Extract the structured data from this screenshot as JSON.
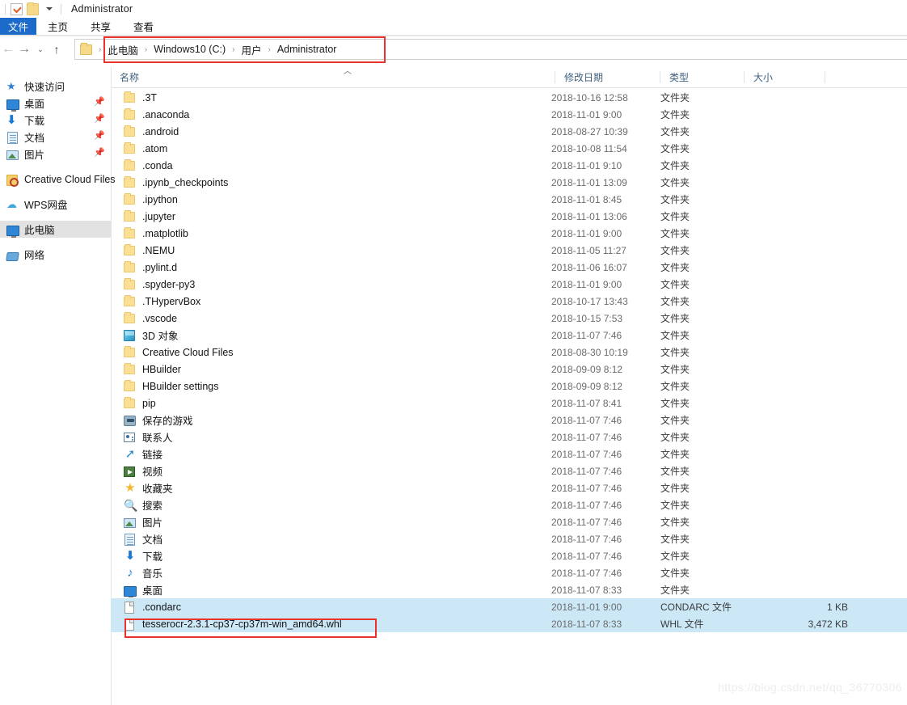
{
  "window": {
    "title": "Administrator",
    "quick_access_icons": [
      "properties-check-icon",
      "new-folder-icon",
      "customize-caret-icon"
    ]
  },
  "ribbon": {
    "file_tab": "文件",
    "tabs": [
      "主页",
      "共享",
      "查看"
    ]
  },
  "navigation": {
    "back": "←",
    "forward": "→",
    "recent": "⌄",
    "up": "↑",
    "breadcrumb": [
      "此电脑",
      "Windows10 (C:)",
      "用户",
      "Administrator"
    ],
    "separator": "›"
  },
  "columns": {
    "name": "名称",
    "date": "修改日期",
    "type": "类型",
    "size": "大小",
    "sort_indicator": "︿"
  },
  "sidebar": {
    "groups": [
      {
        "items": [
          {
            "label": "快速访问",
            "icon": "quick-access-star-icon",
            "pinned": false,
            "selected": false
          },
          {
            "label": "桌面",
            "icon": "desktop-monitor-icon",
            "pinned": true,
            "selected": false
          },
          {
            "label": "下载",
            "icon": "downloads-arrow-icon",
            "pinned": true,
            "selected": false
          },
          {
            "label": "文档",
            "icon": "documents-icon",
            "pinned": true,
            "selected": false
          },
          {
            "label": "图片",
            "icon": "pictures-icon",
            "pinned": true,
            "selected": false
          }
        ]
      },
      {
        "items": [
          {
            "label": "Creative Cloud Files",
            "icon": "creative-cloud-icon",
            "pinned": false,
            "selected": false
          }
        ]
      },
      {
        "items": [
          {
            "label": "WPS网盘",
            "icon": "wps-cloud-icon",
            "pinned": false,
            "selected": false
          }
        ]
      },
      {
        "items": [
          {
            "label": "此电脑",
            "icon": "this-pc-icon",
            "pinned": false,
            "selected": true
          }
        ]
      },
      {
        "items": [
          {
            "label": "网络",
            "icon": "network-icon",
            "pinned": false,
            "selected": false
          }
        ]
      }
    ]
  },
  "files": [
    {
      "name": ".3T",
      "date": "2018-10-16 12:58",
      "type": "文件夹",
      "size": "",
      "icon": "folder-icon",
      "selected": false
    },
    {
      "name": ".anaconda",
      "date": "2018-11-01 9:00",
      "type": "文件夹",
      "size": "",
      "icon": "folder-icon",
      "selected": false
    },
    {
      "name": ".android",
      "date": "2018-08-27 10:39",
      "type": "文件夹",
      "size": "",
      "icon": "folder-icon",
      "selected": false
    },
    {
      "name": ".atom",
      "date": "2018-10-08 11:54",
      "type": "文件夹",
      "size": "",
      "icon": "folder-icon",
      "selected": false
    },
    {
      "name": ".conda",
      "date": "2018-11-01 9:10",
      "type": "文件夹",
      "size": "",
      "icon": "folder-icon",
      "selected": false
    },
    {
      "name": ".ipynb_checkpoints",
      "date": "2018-11-01 13:09",
      "type": "文件夹",
      "size": "",
      "icon": "folder-icon",
      "selected": false
    },
    {
      "name": ".ipython",
      "date": "2018-11-01 8:45",
      "type": "文件夹",
      "size": "",
      "icon": "folder-icon",
      "selected": false
    },
    {
      "name": ".jupyter",
      "date": "2018-11-01 13:06",
      "type": "文件夹",
      "size": "",
      "icon": "folder-icon",
      "selected": false
    },
    {
      "name": ".matplotlib",
      "date": "2018-11-01 9:00",
      "type": "文件夹",
      "size": "",
      "icon": "folder-icon",
      "selected": false
    },
    {
      "name": ".NEMU",
      "date": "2018-11-05 11:27",
      "type": "文件夹",
      "size": "",
      "icon": "folder-icon",
      "selected": false
    },
    {
      "name": ".pylint.d",
      "date": "2018-11-06 16:07",
      "type": "文件夹",
      "size": "",
      "icon": "folder-icon",
      "selected": false
    },
    {
      "name": ".spyder-py3",
      "date": "2018-11-01 9:00",
      "type": "文件夹",
      "size": "",
      "icon": "folder-icon",
      "selected": false
    },
    {
      "name": ".THypervBox",
      "date": "2018-10-17 13:43",
      "type": "文件夹",
      "size": "",
      "icon": "folder-icon",
      "selected": false
    },
    {
      "name": ".vscode",
      "date": "2018-10-15 7:53",
      "type": "文件夹",
      "size": "",
      "icon": "folder-icon",
      "selected": false
    },
    {
      "name": "3D 对象",
      "date": "2018-11-07 7:46",
      "type": "文件夹",
      "size": "",
      "icon": "3d-objects-icon",
      "selected": false
    },
    {
      "name": "Creative Cloud Files",
      "date": "2018-08-30 10:19",
      "type": "文件夹",
      "size": "",
      "icon": "folder-icon",
      "selected": false
    },
    {
      "name": "HBuilder",
      "date": "2018-09-09 8:12",
      "type": "文件夹",
      "size": "",
      "icon": "folder-icon",
      "selected": false
    },
    {
      "name": "HBuilder settings",
      "date": "2018-09-09 8:12",
      "type": "文件夹",
      "size": "",
      "icon": "folder-icon",
      "selected": false
    },
    {
      "name": "pip",
      "date": "2018-11-07 8:41",
      "type": "文件夹",
      "size": "",
      "icon": "folder-icon",
      "selected": false
    },
    {
      "name": "保存的游戏",
      "date": "2018-11-07 7:46",
      "type": "文件夹",
      "size": "",
      "icon": "saved-games-icon",
      "selected": false
    },
    {
      "name": "联系人",
      "date": "2018-11-07 7:46",
      "type": "文件夹",
      "size": "",
      "icon": "contacts-icon",
      "selected": false
    },
    {
      "name": "链接",
      "date": "2018-11-07 7:46",
      "type": "文件夹",
      "size": "",
      "icon": "links-icon",
      "selected": false
    },
    {
      "name": "视频",
      "date": "2018-11-07 7:46",
      "type": "文件夹",
      "size": "",
      "icon": "videos-icon",
      "selected": false
    },
    {
      "name": "收藏夹",
      "date": "2018-11-07 7:46",
      "type": "文件夹",
      "size": "",
      "icon": "favorites-star-icon",
      "selected": false
    },
    {
      "name": "搜索",
      "date": "2018-11-07 7:46",
      "type": "文件夹",
      "size": "",
      "icon": "searches-icon",
      "selected": false
    },
    {
      "name": "图片",
      "date": "2018-11-07 7:46",
      "type": "文件夹",
      "size": "",
      "icon": "pictures-icon",
      "selected": false
    },
    {
      "name": "文档",
      "date": "2018-11-07 7:46",
      "type": "文件夹",
      "size": "",
      "icon": "documents-icon",
      "selected": false
    },
    {
      "name": "下载",
      "date": "2018-11-07 7:46",
      "type": "文件夹",
      "size": "",
      "icon": "downloads-arrow-icon",
      "selected": false
    },
    {
      "name": "音乐",
      "date": "2018-11-07 7:46",
      "type": "文件夹",
      "size": "",
      "icon": "music-icon",
      "selected": false
    },
    {
      "name": "桌面",
      "date": "2018-11-07 8:33",
      "type": "文件夹",
      "size": "",
      "icon": "desktop-monitor-icon",
      "selected": false
    },
    {
      "name": ".condarc",
      "date": "2018-11-01 9:00",
      "type": "CONDARC 文件",
      "size": "1 KB",
      "icon": "file-icon",
      "selected": true
    },
    {
      "name": "tesserocr-2.3.1-cp37-cp37m-win_amd64.whl",
      "date": "2018-11-07 8:33",
      "type": "WHL 文件",
      "size": "3,472 KB",
      "icon": "file-icon",
      "selected": true
    }
  ],
  "annotations": {
    "address_highlight_color": "#e8322b",
    "selection_highlight_color": "#cce8f7"
  },
  "watermark": "https://blog.csdn.net/qq_36770306"
}
